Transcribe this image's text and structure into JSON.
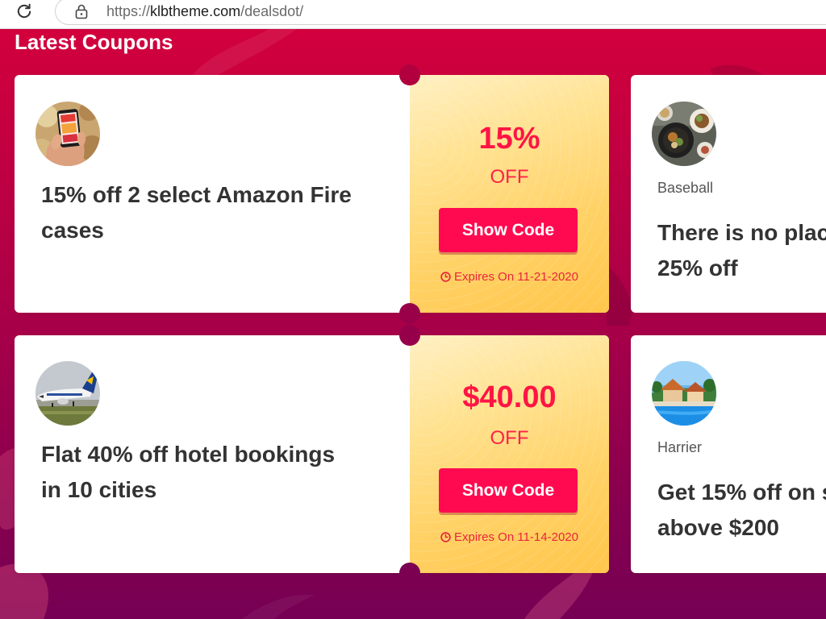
{
  "browser": {
    "url_scheme": "https://",
    "url_host": "klbtheme.com",
    "url_path": "/dealsdot/"
  },
  "section": {
    "title": "Latest Coupons"
  },
  "coupons": [
    {
      "title_lines": [
        "15% off 2 select Amazon Fire",
        "cases"
      ],
      "discount": "15%",
      "off_label": "OFF",
      "button_label": "Show Code",
      "expires": "Expires On 11-21-2020"
    },
    {
      "title_lines": [
        "Flat 40% off hotel bookings",
        "in 10 cities"
      ],
      "discount": "$40.00",
      "off_label": "OFF",
      "button_label": "Show Code",
      "expires": "Expires On 11-14-2020"
    }
  ],
  "side_coupons": [
    {
      "category": "Baseball",
      "title_lines": [
        "There is no plac",
        "25% off"
      ]
    },
    {
      "category": "Harrier",
      "title_lines": [
        "Get 15% off on s",
        "above $200"
      ]
    }
  ],
  "icons": {
    "reload": "reload-icon",
    "lock": "lock-icon",
    "expiry": "clock-icon"
  },
  "colors": {
    "page_gradient_top": "#d6003c",
    "page_gradient_bottom": "#760054",
    "discount_text": "#ff1444",
    "button_bg": "#ff0a50",
    "panel_light": "#fff0c4",
    "panel_dark": "#ffc64b",
    "title_text": "#333333"
  }
}
